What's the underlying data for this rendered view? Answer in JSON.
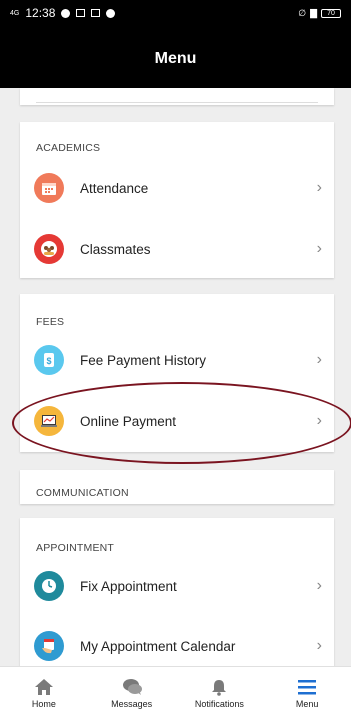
{
  "status_bar": {
    "time": "12:38",
    "network": "4G",
    "battery": "70"
  },
  "header": {
    "title": "Menu"
  },
  "sections": {
    "academics": {
      "title": "ACADEMICS",
      "items": [
        {
          "label": "Attendance",
          "icon": "calendar-icon",
          "color": "#f07a5a"
        },
        {
          "label": "Classmates",
          "icon": "people-icon",
          "color": "#e53935"
        }
      ]
    },
    "fees": {
      "title": "FEES",
      "items": [
        {
          "label": "Fee Payment History",
          "icon": "dollar-document-icon",
          "color": "#5ac8ee"
        },
        {
          "label": "Online Payment",
          "icon": "laptop-chart-icon",
          "color": "#f5b63c"
        }
      ]
    },
    "communication": {
      "title": "COMMUNICATION"
    },
    "appointment": {
      "title": "APPOINTMENT",
      "items": [
        {
          "label": "Fix Appointment",
          "icon": "clock-icon",
          "color": "#1f8a9c"
        },
        {
          "label": "My Appointment Calendar",
          "icon": "hand-calendar-icon",
          "color": "#2f9bd1"
        }
      ]
    }
  },
  "bottom_nav": {
    "items": [
      {
        "label": "Home",
        "icon": "home-icon"
      },
      {
        "label": "Messages",
        "icon": "chat-icon"
      },
      {
        "label": "Notifications",
        "icon": "bell-icon"
      },
      {
        "label": "Menu",
        "icon": "hamburger-icon",
        "active": true
      }
    ],
    "active_color": "#1e6fd1"
  },
  "annotation": {
    "highlight_color": "#7a1420"
  }
}
